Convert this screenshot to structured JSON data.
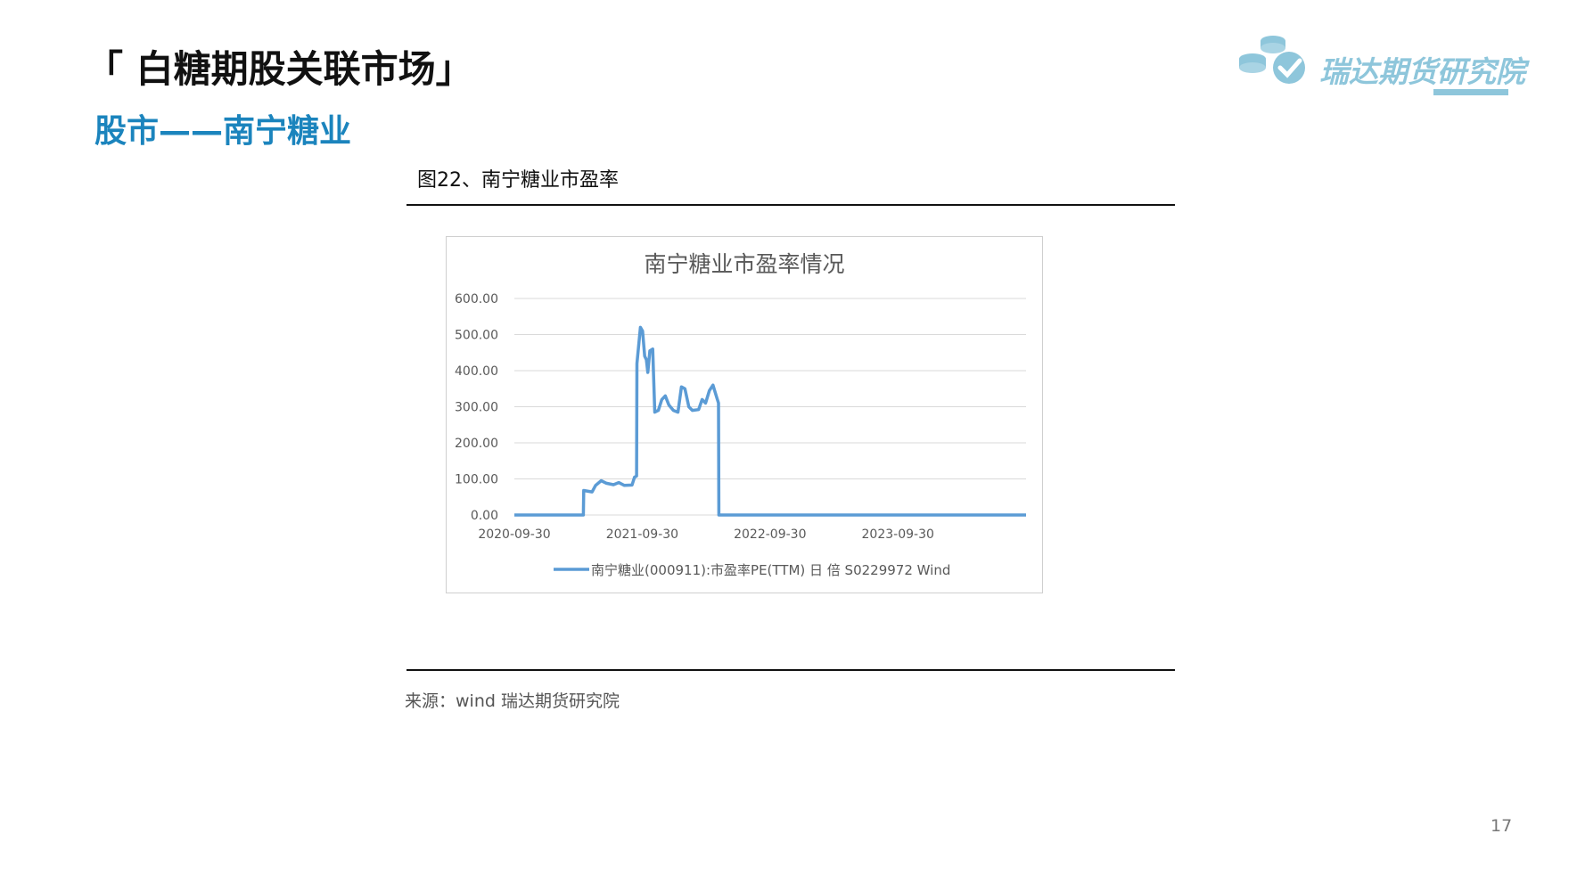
{
  "header": {
    "title": "「 白糖期股关联市场」",
    "subtitle": "股市——南宁糖业"
  },
  "logo": {
    "text": "瑞达期货研究院"
  },
  "figure": {
    "caption": "图22、南宁糖业市盈率"
  },
  "source": "来源：wind   瑞达期货研究院",
  "page_number": "17",
  "colors": {
    "brand_blue": "#1b84bd",
    "series": "#5b9bd5",
    "logo": "#8ec6db"
  },
  "chart_data": {
    "type": "line",
    "title": "南宁糖业市盈率情况",
    "xlabel": "",
    "ylabel": "",
    "ylim": [
      0,
      600
    ],
    "yticks": [
      "0.00",
      "100.00",
      "200.00",
      "300.00",
      "400.00",
      "500.00",
      "600.00"
    ],
    "xrange": [
      "2020-09-30",
      "2024-09-30"
    ],
    "xticks": [
      "2020-09-30",
      "2021-09-30",
      "2022-09-30",
      "2023-09-30"
    ],
    "grid": true,
    "legend_position": "bottom",
    "series": [
      {
        "name": "南宁糖业(000911):市盈率PE(TTM) 日 倍 S0229972 Wind",
        "points": [
          [
            "2020-09-30",
            0
          ],
          [
            "2021-04-15",
            0
          ],
          [
            "2021-04-16",
            68
          ],
          [
            "2021-05-10",
            64
          ],
          [
            "2021-05-20",
            82
          ],
          [
            "2021-06-05",
            95
          ],
          [
            "2021-06-20",
            88
          ],
          [
            "2021-07-10",
            84
          ],
          [
            "2021-07-25",
            90
          ],
          [
            "2021-08-10",
            82
          ],
          [
            "2021-09-01",
            83
          ],
          [
            "2021-09-08",
            105
          ],
          [
            "2021-09-14",
            108
          ],
          [
            "2021-09-15",
            420
          ],
          [
            "2021-09-25",
            520
          ],
          [
            "2021-10-01",
            510
          ],
          [
            "2021-10-07",
            440
          ],
          [
            "2021-10-12",
            430
          ],
          [
            "2021-10-16",
            395
          ],
          [
            "2021-10-22",
            455
          ],
          [
            "2021-10-30",
            460
          ],
          [
            "2021-11-05",
            285
          ],
          [
            "2021-11-15",
            290
          ],
          [
            "2021-11-25",
            320
          ],
          [
            "2021-12-05",
            330
          ],
          [
            "2021-12-15",
            305
          ],
          [
            "2021-12-28",
            290
          ],
          [
            "2022-01-10",
            285
          ],
          [
            "2022-01-20",
            355
          ],
          [
            "2022-01-30",
            350
          ],
          [
            "2022-02-10",
            300
          ],
          [
            "2022-02-20",
            290
          ],
          [
            "2022-03-10",
            292
          ],
          [
            "2022-03-20",
            320
          ],
          [
            "2022-03-30",
            310
          ],
          [
            "2022-04-10",
            345
          ],
          [
            "2022-04-20",
            360
          ],
          [
            "2022-05-01",
            325
          ],
          [
            "2022-05-06",
            310
          ],
          [
            "2022-05-07",
            0
          ],
          [
            "2024-09-30",
            0
          ]
        ]
      }
    ]
  }
}
